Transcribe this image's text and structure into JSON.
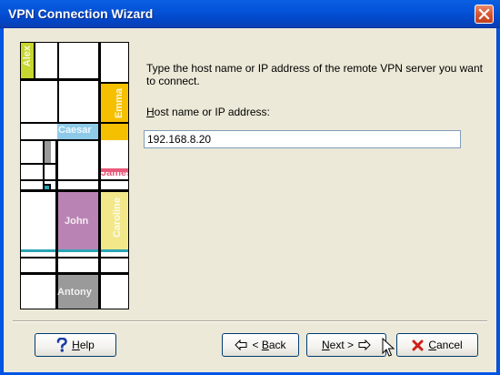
{
  "window": {
    "title": "VPN Connection Wizard",
    "close_icon": "close-icon"
  },
  "art": {
    "names": [
      "Alex",
      "Emma",
      "Caesar",
      "James",
      "John",
      "Caroline",
      "Antony"
    ],
    "colors": {
      "yellow_green": "#c8d630",
      "orange": "#f5c000",
      "light_blue": "#8ecae8",
      "purple": "#b984b4",
      "light_yellow": "#f2e88a",
      "gray": "#9a9a9a",
      "teal": "#2aa5b5",
      "pink": "#e85a7a"
    }
  },
  "page": {
    "instruction": "Type the host name or IP address of the remote VPN server you want to connect.",
    "host_label_access": "H",
    "host_label_rest": "ost name or IP address:",
    "host_value": "192.168.8.20"
  },
  "buttons": {
    "help_access": "H",
    "help_rest": "elp",
    "back_prefix": "< ",
    "back_access": "B",
    "back_rest": "ack",
    "next_access": "N",
    "next_rest": "ext >",
    "cancel_access": "C",
    "cancel_rest": "ancel"
  },
  "colors": {
    "titlebar": "#0453d8",
    "dialog_bg": "#ece9d8",
    "accent_blue": "#003c74"
  }
}
